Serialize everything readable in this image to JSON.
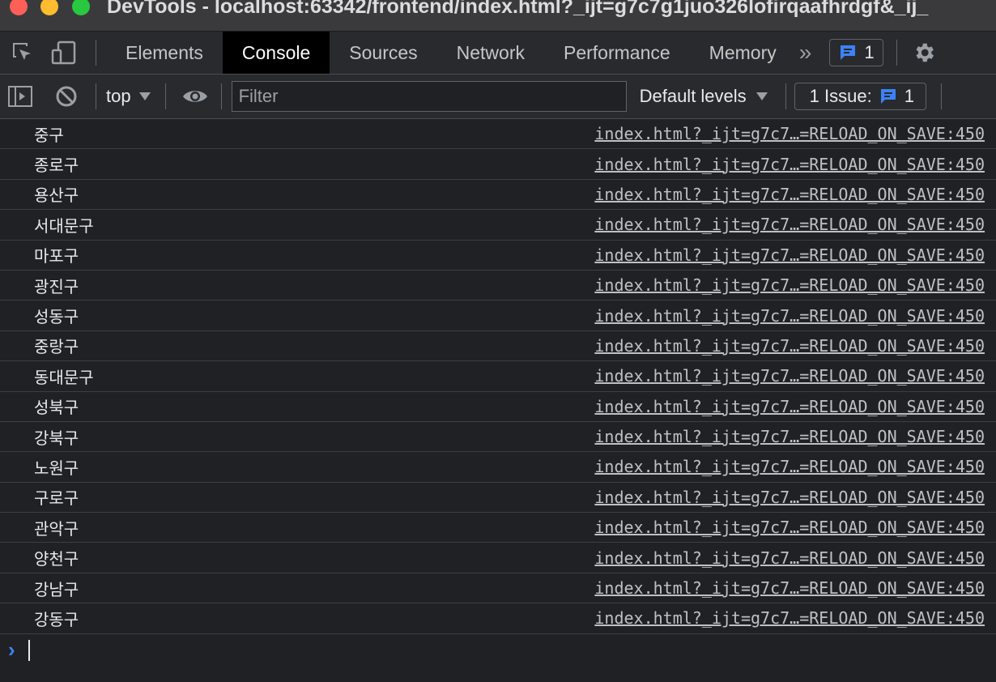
{
  "window": {
    "title": "DevTools - localhost:63342/frontend/index.html?_ijt=g7c7g1juo326lofirqaafhrdgf&_ij_"
  },
  "tabs": [
    "Elements",
    "Console",
    "Sources",
    "Network",
    "Performance",
    "Memory"
  ],
  "active_tab": "Console",
  "tabbar": {
    "more_glyph": "»",
    "messages_count": "1"
  },
  "toolbar": {
    "context": "top",
    "filter_placeholder": "Filter",
    "filter_value": "",
    "levels": "Default levels",
    "issues_label": "1 Issue:",
    "issues_count": "1"
  },
  "logs": [
    {
      "text": "중구",
      "source": "index.html?_ijt=g7c7…=RELOAD_ON_SAVE:450"
    },
    {
      "text": "종로구",
      "source": "index.html?_ijt=g7c7…=RELOAD_ON_SAVE:450"
    },
    {
      "text": "용산구",
      "source": "index.html?_ijt=g7c7…=RELOAD_ON_SAVE:450"
    },
    {
      "text": "서대문구",
      "source": "index.html?_ijt=g7c7…=RELOAD_ON_SAVE:450"
    },
    {
      "text": "마포구",
      "source": "index.html?_ijt=g7c7…=RELOAD_ON_SAVE:450"
    },
    {
      "text": "광진구",
      "source": "index.html?_ijt=g7c7…=RELOAD_ON_SAVE:450"
    },
    {
      "text": "성동구",
      "source": "index.html?_ijt=g7c7…=RELOAD_ON_SAVE:450"
    },
    {
      "text": "중랑구",
      "source": "index.html?_ijt=g7c7…=RELOAD_ON_SAVE:450"
    },
    {
      "text": "동대문구",
      "source": "index.html?_ijt=g7c7…=RELOAD_ON_SAVE:450"
    },
    {
      "text": "성북구",
      "source": "index.html?_ijt=g7c7…=RELOAD_ON_SAVE:450"
    },
    {
      "text": "강북구",
      "source": "index.html?_ijt=g7c7…=RELOAD_ON_SAVE:450"
    },
    {
      "text": "노원구",
      "source": "index.html?_ijt=g7c7…=RELOAD_ON_SAVE:450"
    },
    {
      "text": "구로구",
      "source": "index.html?_ijt=g7c7…=RELOAD_ON_SAVE:450"
    },
    {
      "text": "관악구",
      "source": "index.html?_ijt=g7c7…=RELOAD_ON_SAVE:450"
    },
    {
      "text": "양천구",
      "source": "index.html?_ijt=g7c7…=RELOAD_ON_SAVE:450"
    },
    {
      "text": "강남구",
      "source": "index.html?_ijt=g7c7…=RELOAD_ON_SAVE:450"
    },
    {
      "text": "강동구",
      "source": "index.html?_ijt=g7c7…=RELOAD_ON_SAVE:450"
    }
  ],
  "prompt": {
    "glyph": "›"
  },
  "colors": {
    "background": "#202124",
    "toolbar": "#292a2d",
    "accent_blue": "#3c82f6",
    "traffic_red": "#fe5f57",
    "traffic_yellow": "#febc2e",
    "traffic_green": "#28c840"
  }
}
